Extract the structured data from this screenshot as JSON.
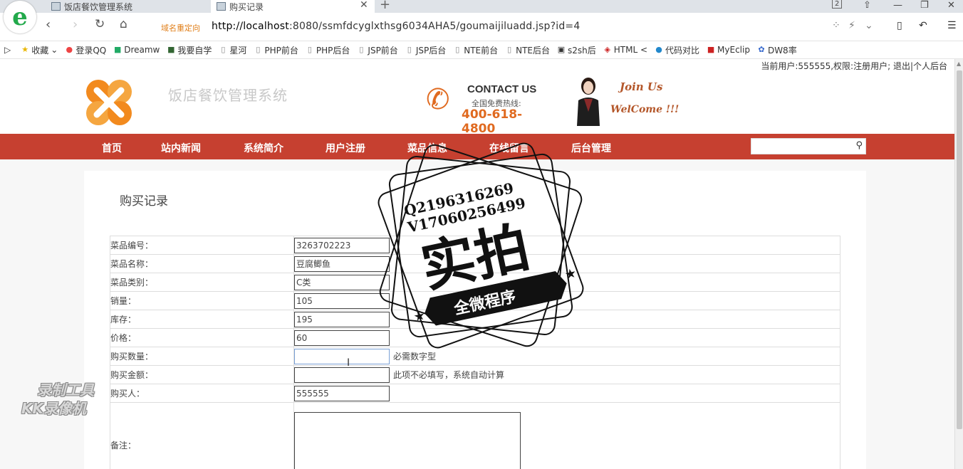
{
  "browser": {
    "tabs": [
      {
        "label": "饭店餐饮管理系统"
      },
      {
        "label": "购买记录"
      }
    ],
    "tab_count": "2",
    "redirect_label": "域名重定向",
    "url_host": "http://localhost",
    "url_rest": ":8080/ssmfdcyglxthsg6034AHA5/goumaijiluadd.jsp?id=4",
    "bookmarks": [
      "收藏",
      "登录QQ",
      "Dreamw",
      "我要自学",
      "星河",
      "PHP前台",
      "PHP后台",
      "JSP前台",
      "JSP后台",
      "NTE前台",
      "NTE后台",
      "s2sh后",
      "HTML <",
      "代码对比",
      "MyEclip",
      "DW8率"
    ]
  },
  "site": {
    "user_info": "当前用户:555555,权限:注册用户; 退出|个人后台",
    "title": "饭店餐饮管理系统",
    "contact_title": "CONTACT US",
    "contact_sub": "全国免费热线:",
    "contact_phone": "400-618-4800",
    "join_text": "Join Us",
    "welcome_text": "WelCome !!!",
    "nav": [
      "首页",
      "站内新闻",
      "系统简介",
      "用户注册",
      "菜品信息",
      "在线留言",
      "后台管理"
    ]
  },
  "form": {
    "title": "购买记录",
    "rows": [
      {
        "label": "菜品编号：",
        "value": "3263702223"
      },
      {
        "label": "菜品名称：",
        "value": "豆腐鲫鱼"
      },
      {
        "label": "菜品类别：",
        "value": "C类"
      },
      {
        "label": "销量：",
        "value": "105"
      },
      {
        "label": "库存：",
        "value": "195"
      },
      {
        "label": "价格：",
        "value": "60"
      },
      {
        "label": "购买数量：",
        "value": "",
        "hint": "必需数字型"
      },
      {
        "label": "购买金额：",
        "value": "",
        "hint": "此项不必填写，系统自动计算"
      },
      {
        "label": "购买人：",
        "value": "555555"
      },
      {
        "label": "备注：",
        "value": ""
      }
    ]
  },
  "watermark": {
    "qq": "Q2196316269",
    "v": "V17060256499",
    "main": "实拍",
    "banner": "全微程序"
  },
  "recorder": {
    "line1": "录制工具",
    "line2": "KK录像机"
  }
}
